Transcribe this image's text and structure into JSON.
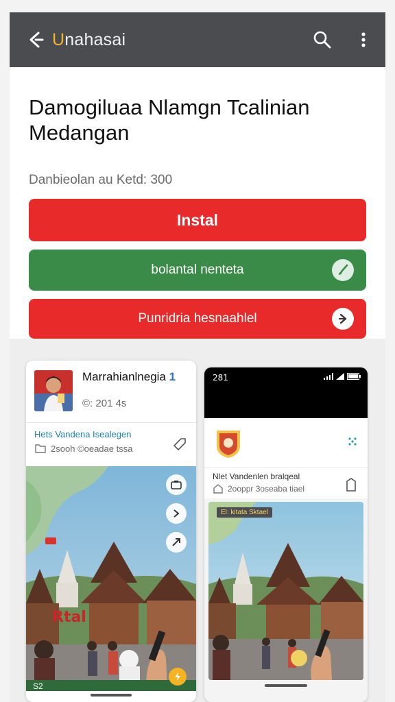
{
  "app_bar": {
    "title_first_letter": "U",
    "title_rest": "nahasai",
    "back_icon": "back-arrow-icon",
    "search_icon": "search-icon",
    "menu_icon": "more-vert-icon",
    "background": "#4a4c50",
    "accent": "#f5b324"
  },
  "main": {
    "headline": "Damogiluaa Nlamgn Tcalinian Medangan",
    "subinfo": "Danbieolan au Ketd: 300",
    "buttons": {
      "install_label": "Instal",
      "secondary_label": "bolantal nenteta",
      "tertiary_label": "Punridria hesnaahlel",
      "secondary_icon": "brush-icon",
      "tertiary_icon": "arrow-right-icon"
    },
    "colors": {
      "red": "#e82a2a",
      "green": "#3a8a48"
    }
  },
  "gallery": {
    "left_card": {
      "profile_name": "Marrahianlnegia",
      "profile_mark": "1",
      "profile_meta": "©: 201 4s",
      "post_title": "Hets Vandena Isealegen",
      "post_meta": "2sooh ©oeadae tssa",
      "brand_text": "Rtal",
      "footer_label": "S2"
    },
    "right_card": {
      "status_time": "281",
      "post_title": "Nlet Vandenlen bralqeal",
      "post_meta": "2ooppr 3oseaba tiael",
      "tag_label": "El: kitata Sktael"
    }
  }
}
